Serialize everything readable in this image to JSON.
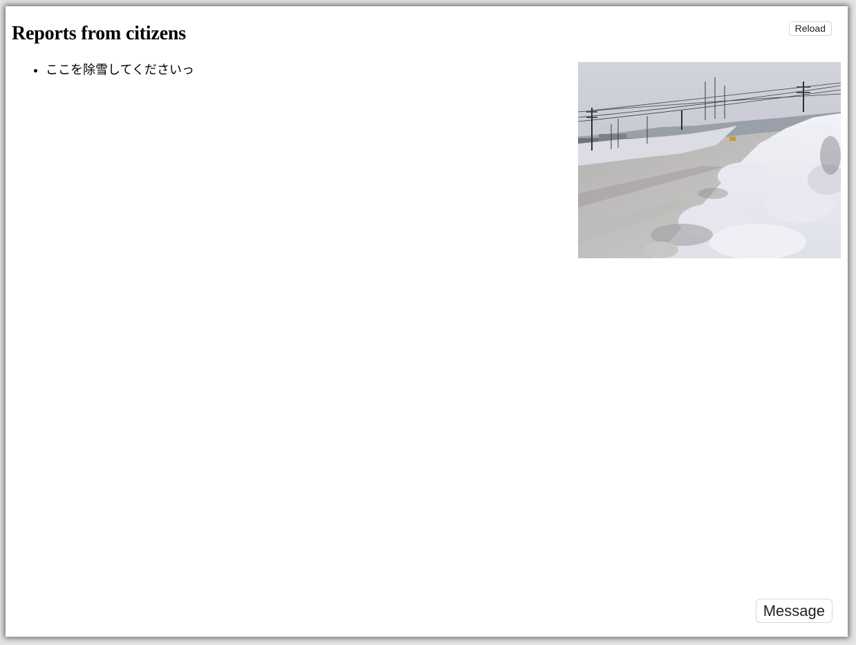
{
  "header": {
    "title": "Reports from citizens",
    "reload_label": "Reload"
  },
  "reports": [
    {
      "text": "ここを除雪してくださいっ",
      "photo": "snowy-road-photo"
    }
  ],
  "footer": {
    "message_label": "Message"
  }
}
